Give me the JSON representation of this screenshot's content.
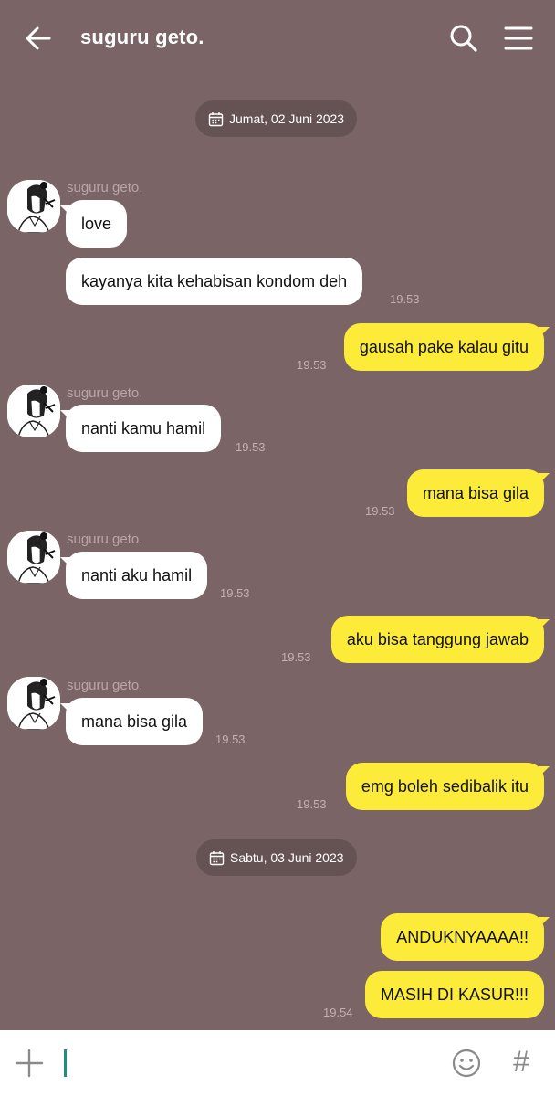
{
  "header": {
    "back_icon": "arrow-left-icon",
    "title": "suguru geto.",
    "search_icon": "search-icon",
    "menu_icon": "hamburger-menu-icon"
  },
  "dates": [
    "Jumat, 02 Juni 2023",
    "Sabtu, 03 Juni 2023"
  ],
  "messages": [
    {
      "sender": "suguru geto.",
      "text": "love"
    },
    {
      "text": "kayanya kita kehabisan kondom deh",
      "time": "19.53"
    },
    {
      "text": "gausah pake kalau gitu",
      "time": "19.53"
    },
    {
      "sender": "suguru geto.",
      "text": "nanti kamu hamil",
      "time": "19.53"
    },
    {
      "text": "mana bisa gila",
      "time": "19.53"
    },
    {
      "sender": "suguru geto.",
      "text": "nanti aku hamil",
      "time": "19.53"
    },
    {
      "text": "aku bisa tanggung jawab",
      "time": "19.53"
    },
    {
      "sender": "suguru geto.",
      "text": "mana bisa gila",
      "time": "19.53"
    },
    {
      "text": "emg boleh sedibalik itu",
      "time": "19.53"
    },
    {
      "text": "ANDUKNYAAAA!!"
    },
    {
      "text": "MASIH DI KASUR!!!",
      "time": "19.54"
    }
  ],
  "input": {
    "plus_icon": "plus-icon",
    "value": "",
    "emoji_icon": "emoji-icon",
    "hash_label": "#"
  },
  "colors": {
    "background": "#7a6465",
    "incoming_bubble": "#ffffff",
    "outgoing_bubble": "#fdeb3a",
    "date_pill": "#655253"
  }
}
